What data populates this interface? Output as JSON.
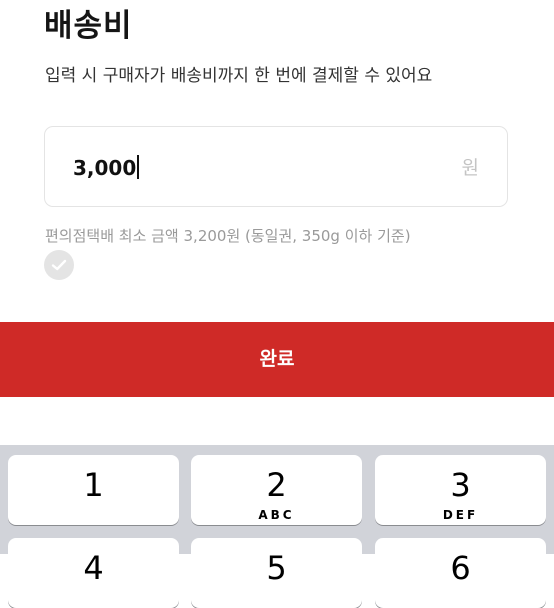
{
  "header": {
    "title": "배송비",
    "subtitle": "입력 시 구매자가 배송비까지 한 번에 결제할 수 있어요"
  },
  "price_input": {
    "value": "3,000",
    "unit": "원"
  },
  "hint": {
    "text": "편의점택배 최소 금액 3,200원 (동일권, 350g 이하 기준)",
    "checked": false
  },
  "action": {
    "complete_label": "완료"
  },
  "keyboard": {
    "keys": [
      {
        "digit": "1",
        "letters": ""
      },
      {
        "digit": "2",
        "letters": "ABC"
      },
      {
        "digit": "3",
        "letters": "DEF"
      },
      {
        "digit": "4",
        "letters": ""
      },
      {
        "digit": "5",
        "letters": ""
      },
      {
        "digit": "6",
        "letters": ""
      }
    ]
  },
  "colors": {
    "accent": "#cf2a27",
    "keyboard_bg": "#d1d3d9"
  },
  "icons": {
    "check": "check-icon"
  }
}
